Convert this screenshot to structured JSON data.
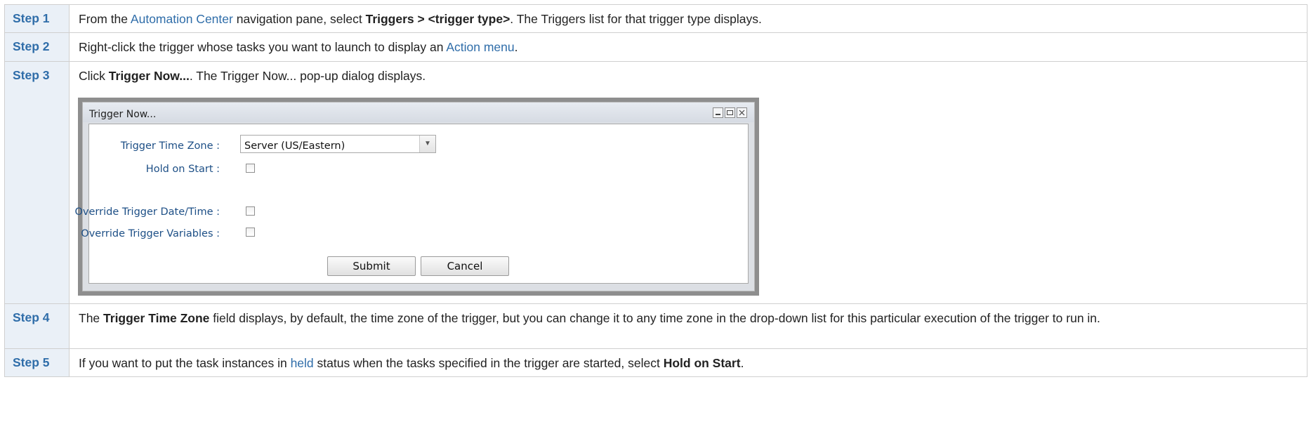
{
  "steps": [
    {
      "label": "Step 1",
      "text_1": "From the ",
      "link_1": "Automation Center",
      "text_2": " navigation pane, select ",
      "bold_1": "Triggers > <trigger type>",
      "text_3": ". The Triggers list for that trigger type displays."
    },
    {
      "label": "Step 2",
      "text_1": "Right-click the trigger whose tasks you want to launch to display an ",
      "link_1": "Action menu",
      "text_2": "."
    },
    {
      "label": "Step 3",
      "text_1": "Click ",
      "bold_1": "Trigger Now...",
      "text_2": ". The Trigger Now... pop-up dialog displays."
    },
    {
      "label": "Step 4",
      "text_1": "The ",
      "bold_1": "Trigger Time Zone",
      "text_2": " field displays, by default, the time zone of the trigger, but you can change it to any time zone in the drop-down list for this particular execution of the trigger to run in."
    },
    {
      "label": "Step 5",
      "text_1": "If you want to put the task instances in ",
      "link_1": "held",
      "text_2": " status when the tasks specified in the trigger are started, select ",
      "bold_1": "Hold on Start",
      "text_3": "."
    }
  ],
  "dialog": {
    "title": "Trigger Now...",
    "fields": {
      "time_zone_label": "Trigger Time Zone :",
      "time_zone_value": "Server (US/Eastern)",
      "hold_on_start_label": "Hold on Start :",
      "override_datetime_label": "Override Trigger Date/Time :",
      "override_variables_label": "Override Trigger Variables :"
    },
    "buttons": {
      "submit": "Submit",
      "cancel": "Cancel"
    },
    "window_controls": [
      "minimize-icon",
      "maximize-icon",
      "close-icon"
    ]
  },
  "colors": {
    "link": "#2f6da9",
    "step_label_bg": "#eaf0f7",
    "dialog_label": "#1d4f86"
  }
}
